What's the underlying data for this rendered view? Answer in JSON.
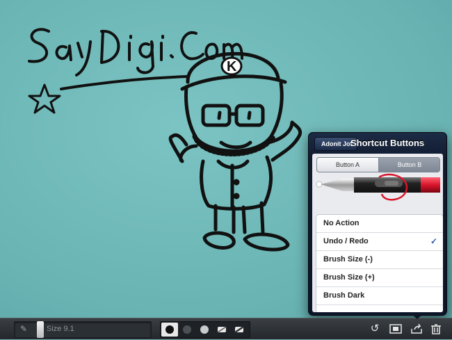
{
  "toolbar": {
    "size_label": "Size 9.1",
    "brushes": [
      {
        "name": "black-brush",
        "color": "#111111",
        "selected": true
      },
      {
        "name": "dark-gray-brush",
        "color": "#4b5055",
        "selected": false
      },
      {
        "name": "light-gray-brush",
        "color": "#c9cbcd",
        "selected": false
      },
      {
        "name": "eraser-soft",
        "color": "#e8e8e8",
        "selected": false
      },
      {
        "name": "eraser-hard",
        "color": "#e8e8e8",
        "selected": false
      }
    ],
    "tools": [
      "undo-icon",
      "layers-icon",
      "share-icon",
      "trash-icon"
    ]
  },
  "drawing": {
    "handwriting": "SayDigi.Com",
    "cap_letter": "K"
  },
  "popover": {
    "back_label": "Adonit Jot",
    "title": "Shortcut Buttons",
    "segments": [
      "Button A",
      "Button B"
    ],
    "active_segment": "Button B",
    "options": [
      {
        "label": "No Action",
        "checked": false
      },
      {
        "label": "Undo / Redo",
        "checked": true
      },
      {
        "label": "Brush Size (-)",
        "checked": false
      },
      {
        "label": "Brush Size (+)",
        "checked": false
      },
      {
        "label": "Brush Dark",
        "checked": false
      }
    ],
    "check_glyph": "✓"
  },
  "colors": {
    "canvas": "#6fb8b8",
    "popover_header": "#0f1a2e",
    "accent_check": "#2a5aa8",
    "pen_red": "#d9152b"
  }
}
